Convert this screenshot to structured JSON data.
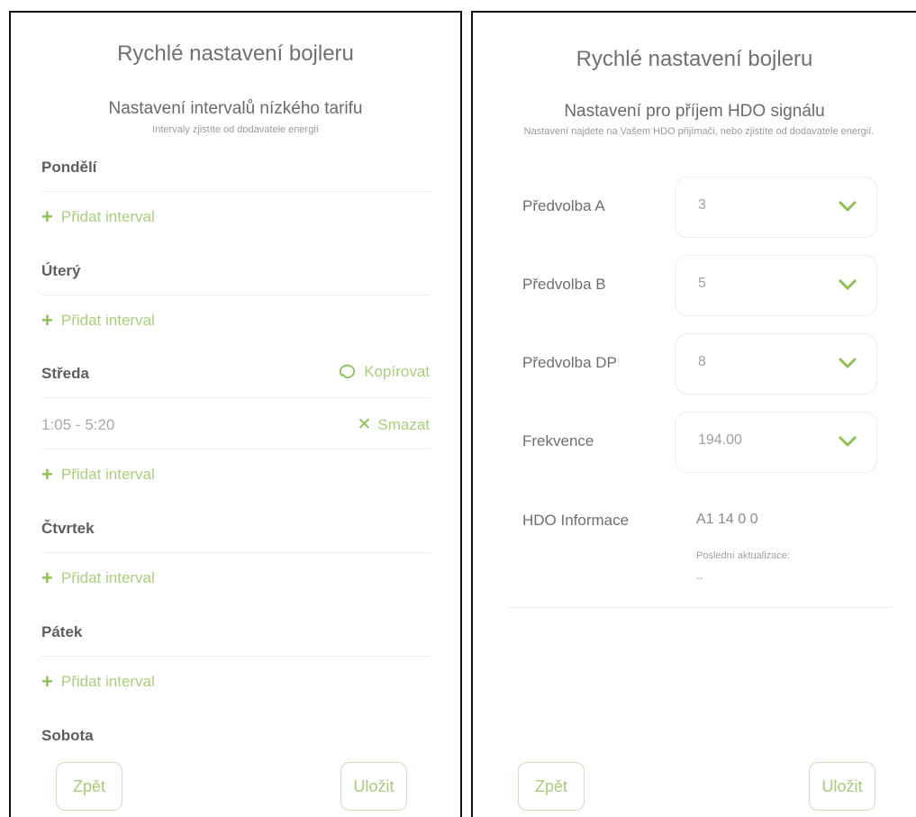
{
  "left": {
    "title": "Rychlé nastavení bojleru",
    "subtitle": "Nastavení intervalů nízkého tarifu",
    "hint": "Intervaly zjistíte od dodavatele energií",
    "add_label": "Přidat interval",
    "days": [
      {
        "name": "Pondělí"
      },
      {
        "name": "Úterý"
      },
      {
        "name": "Středa",
        "copy_label": "Kopírovat",
        "interval": "1:05 - 5:20",
        "delete_label": "Smazat"
      },
      {
        "name": "Čtvrtek"
      },
      {
        "name": "Pátek"
      },
      {
        "name": "Sobota"
      }
    ],
    "back_label": "Zpět",
    "save_label": "Uložit"
  },
  "right": {
    "title": "Rychlé nastavení bojleru",
    "subtitle": "Nastavení pro příjem HDO signálu",
    "hint": "Nastavení najdete na Vašem HDO přijímači, nebo zjistíte od dodavatele energií.",
    "fields": [
      {
        "label": "Předvolba A",
        "value": "3"
      },
      {
        "label": "Předvolba B",
        "value": "5"
      },
      {
        "label": "Předvolba DP",
        "value": "8"
      },
      {
        "label": "Frekvence",
        "value": "194.00"
      }
    ],
    "info": {
      "label": "HDO Informace",
      "value": "A1 14 0 0",
      "last_update_label": "Poslední aktualizace:",
      "last_update_value": "--"
    },
    "back_label": "Zpět",
    "save_label": "Uložit"
  },
  "colors": {
    "accent": "#8cc152",
    "accent_light": "#a9cf7c",
    "text": "#6e6e6e",
    "muted": "#a0a0a0"
  }
}
